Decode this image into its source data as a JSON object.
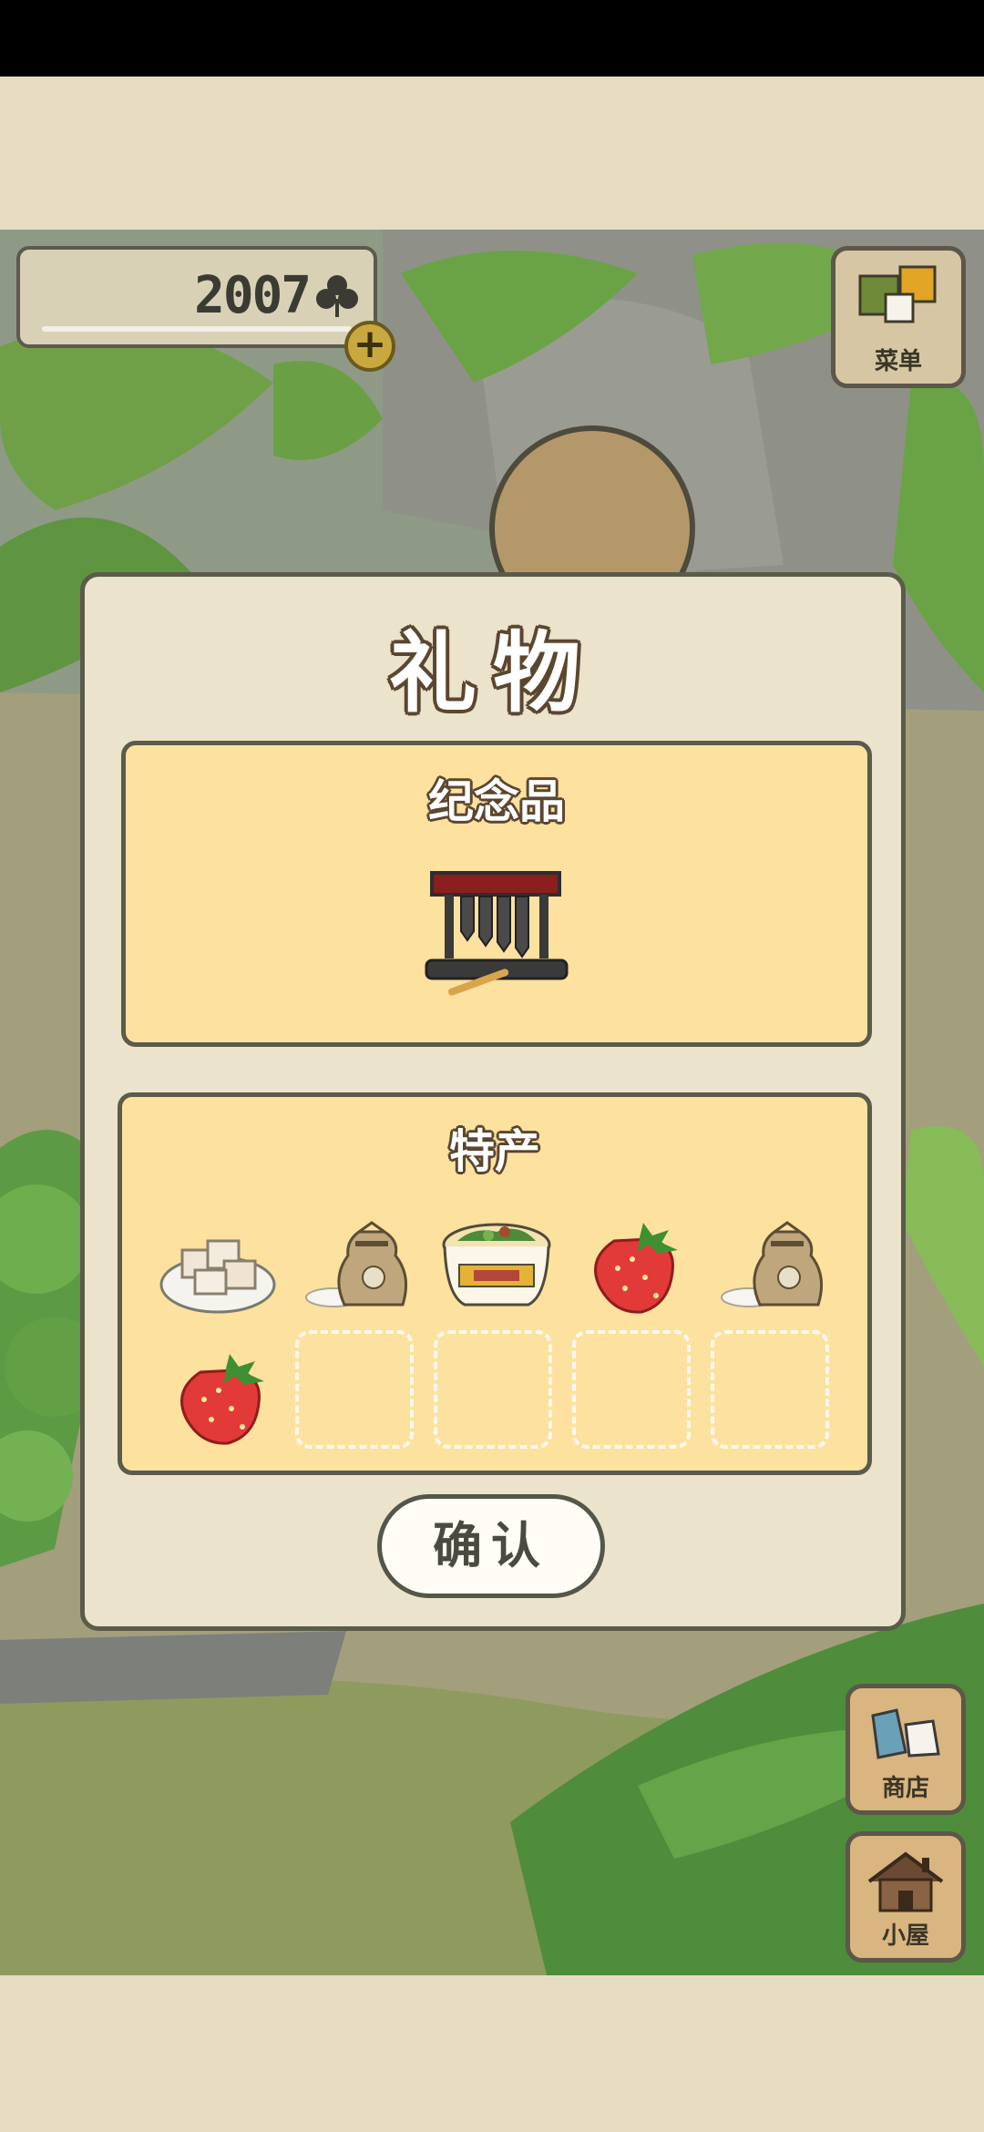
{
  "hud": {
    "clover_count": "2007",
    "menu_label": "菜单",
    "shop_label": "商店",
    "house_label": "小屋"
  },
  "dialog": {
    "title": "礼物",
    "souvenir_title": "纪念品",
    "souvenir_item": "xylophone-bells",
    "specialty_title": "特产",
    "specialty_items": [
      "tofu-plate",
      "rice-sack",
      "noodle-bowl",
      "strawberry",
      "rice-sack",
      "strawberry"
    ],
    "empty_slots": 4,
    "confirm_label": "确认"
  },
  "colors": {
    "dialog_bg": "#ebe3cc",
    "section_bg": "#fde19f",
    "border": "#5a5b4a"
  }
}
